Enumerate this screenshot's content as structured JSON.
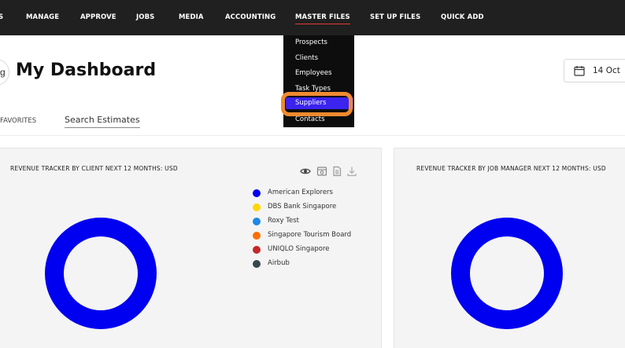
{
  "nav": {
    "items": [
      {
        "label": "S"
      },
      {
        "label": "MANAGE"
      },
      {
        "label": "APPROVE"
      },
      {
        "label": "JOBS"
      },
      {
        "label": "MEDIA"
      },
      {
        "label": "ACCOUNTING"
      },
      {
        "label": "MASTER FILES"
      },
      {
        "label": "SET UP FILES"
      },
      {
        "label": "QUICK ADD"
      }
    ],
    "active": "MASTER FILES"
  },
  "dropdown": {
    "items": [
      {
        "label": "Prospects"
      },
      {
        "label": "Clients"
      },
      {
        "label": "Employees"
      },
      {
        "label": "Task Types"
      },
      {
        "label": "Suppliers"
      },
      {
        "label": "Contacts"
      }
    ],
    "selected": "Suppliers",
    "highlight_color": "#ef8a2f",
    "selected_color": "#3b23f0"
  },
  "header": {
    "back_icon": "back-arrow-icon",
    "title": "My Dashboard",
    "date_label": "14 Oct",
    "date_icon": "calendar-icon"
  },
  "tabs": {
    "favorites": "FAVORITES",
    "search": "Search Estimates"
  },
  "cards": [
    {
      "title": "REVENUE TRACKER BY CLIENT NEXT 12 MONTHS: USD",
      "tools": [
        "eye-icon",
        "image-icon",
        "document-icon",
        "download-icon"
      ],
      "donut_color": "#0000f0",
      "legend": [
        {
          "label": "American Explorers",
          "color": "#0000f0"
        },
        {
          "label": "DBS Bank Singapore",
          "color": "#ffd600"
        },
        {
          "label": "Roxy Test",
          "color": "#1e88e5"
        },
        {
          "label": "Singapore Tourism Board",
          "color": "#ff6d00"
        },
        {
          "label": "UNIQLO Singapore",
          "color": "#c62828"
        },
        {
          "label": "Airbub",
          "color": "#37474f"
        }
      ]
    },
    {
      "title": "REVENUE TRACKER BY JOB MANAGER NEXT 12 MONTHS: USD",
      "donut_color": "#0000f0"
    }
  ]
}
